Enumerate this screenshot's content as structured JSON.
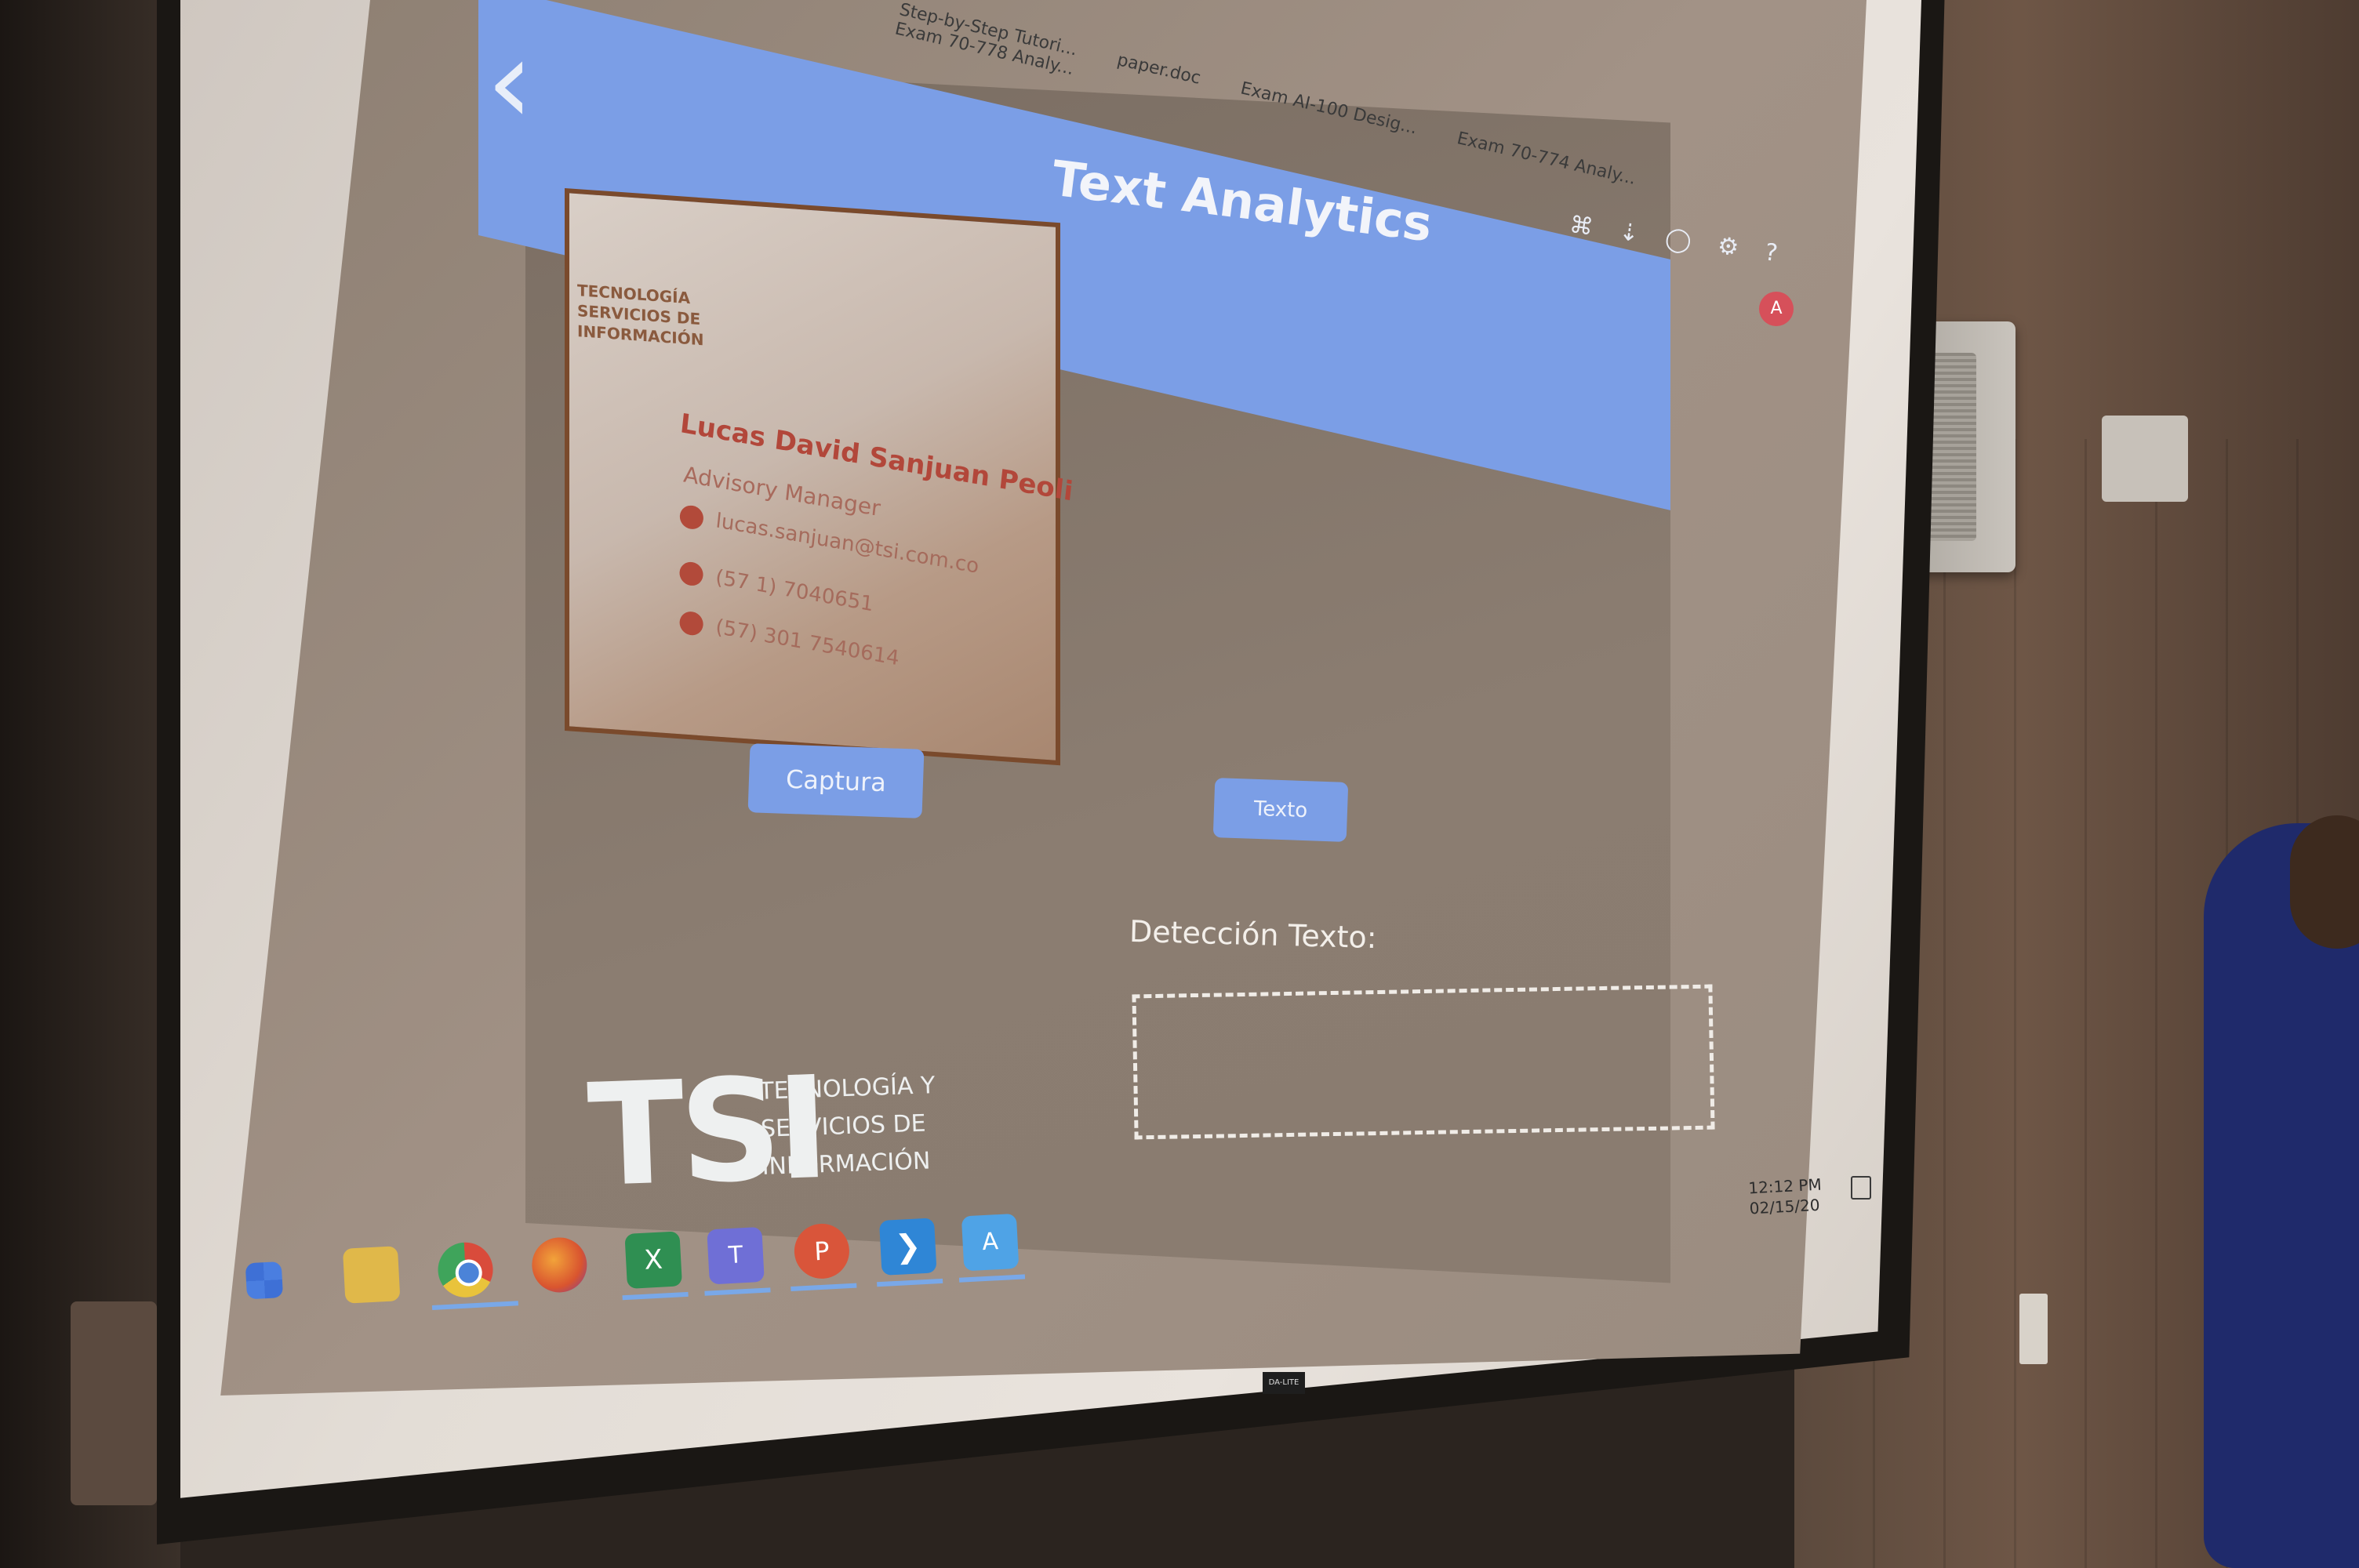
{
  "browser": {
    "tabs": [
      "Step-by-Step Tutori...",
      "paper.doc",
      "Exam AI-100 Desig...",
      "Exam 70-774 Analy...",
      "Exam 70-778 Analy..."
    ]
  },
  "app": {
    "title": "Text Analytics",
    "back_icon": "chevron-left-icon",
    "avatar_letter": "A"
  },
  "card": {
    "brand": "TECNOLOGÍA SERVICIOS DE INFORMACIÓN",
    "name": "Lucas David Sanjuan Peoli",
    "role": "Advisory Manager",
    "email": "lucas.sanjuan@tsi.com.co",
    "phone1": "(57 1) 7040651",
    "phone2": "(57) 301 7540614"
  },
  "buttons": {
    "capture_label": "Captura",
    "text_label": "Texto"
  },
  "detection": {
    "label": "Detección Texto:",
    "result": ""
  },
  "logo": {
    "mark": "TSI",
    "line1": "TECNOLOGÍA Y",
    "line2": "SERVICIOS DE",
    "line3": "INFORMACIÓN"
  },
  "taskbar": {
    "apps": [
      "windows-start-icon",
      "file-explorer-icon",
      "chrome-icon",
      "firefox-icon",
      "excel-icon",
      "teams-icon",
      "powerpoint-icon",
      "vscode-icon",
      "azure-icon"
    ],
    "excel_glyph": "X",
    "teams_glyph": "T",
    "ppt_glyph": "P",
    "vscode_glyph": "❯",
    "azure_glyph": "A"
  },
  "tray": {
    "time": "12:12 PM",
    "date": "02/15/20"
  },
  "screen_brand": "DA-LITE",
  "colors": {
    "accent": "#7b9ee6",
    "card_name": "#b2473a"
  }
}
